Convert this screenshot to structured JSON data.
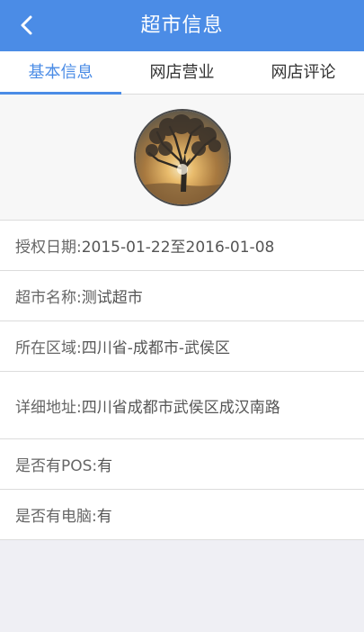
{
  "header": {
    "title": "超市信息",
    "back_icon": "chevron-left-icon"
  },
  "tabs": [
    {
      "label": "基本信息",
      "active": true
    },
    {
      "label": "网店营业",
      "active": false
    },
    {
      "label": "网店评论",
      "active": false
    }
  ],
  "profile": {
    "avatar_icon": "tree-sunset-avatar"
  },
  "info": {
    "auth_date": {
      "label": "授权日期: ",
      "value": "2015-01-22至2016-01-08"
    },
    "store_name": {
      "label": "超市名称: ",
      "value": "测试超市"
    },
    "region": {
      "label": "所在区域: ",
      "value": "四川省-成都市-武侯区"
    },
    "address": {
      "label": "详细地址: ",
      "value": "四川省成都市武侯区成汉南路"
    },
    "has_pos": {
      "label": "是否有POS: ",
      "value": "有"
    },
    "has_computer": {
      "label": "是否有电脑: ",
      "value": "有"
    }
  },
  "colors": {
    "accent": "#4b8ce6",
    "background": "#efeff4",
    "divider": "#dcdcdc"
  }
}
